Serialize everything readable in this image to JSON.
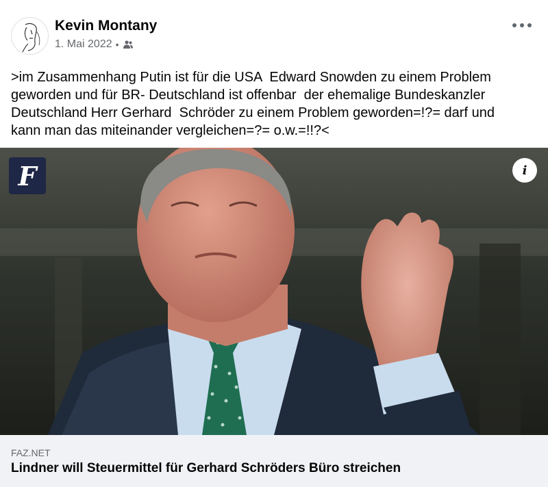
{
  "post": {
    "author": "Kevin Montany",
    "date": "1. Mai 2022",
    "meta_separator": "•",
    "audience_icon": "friends-icon",
    "more_icon": "more-options-icon",
    "text": ">im Zusammenhang Putin ist für die USA  Edward Snowden zu einem Problem\ngeworden und für BR- Deutschland ist offenbar  der ehemalige Bundeskanzler\nDeutschland Herr Gerhard  Schröder zu einem Problem geworden=!?= darf und\nkann man das miteinander vergleichen=?= o.w.=!!?<"
  },
  "image": {
    "publisher_logo": "F",
    "info_label": "i"
  },
  "link": {
    "domain": "FAZ.NET",
    "title": "Lindner will Steuermittel für Gerhard Schröders Büro streichen"
  },
  "colors": {
    "secondary_text": "#65676b",
    "link_background": "#f0f2f5",
    "faz_badge": "#1e2745"
  }
}
